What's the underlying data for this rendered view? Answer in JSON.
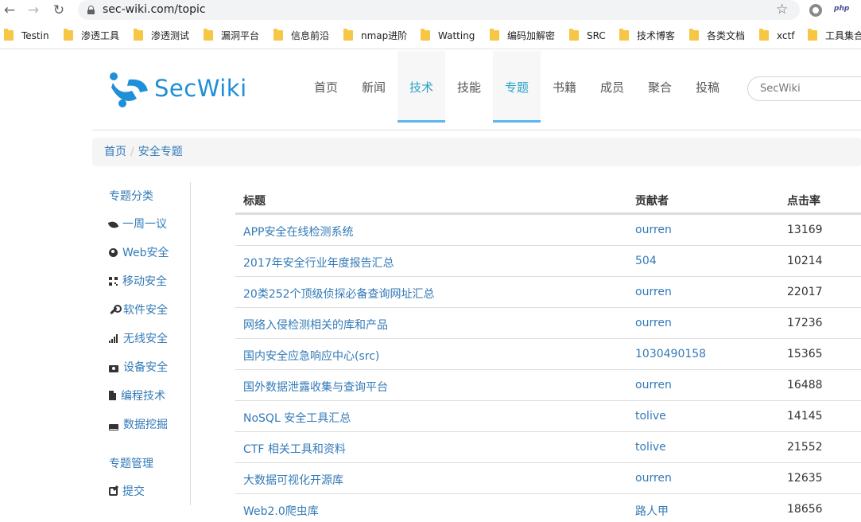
{
  "browser": {
    "url": "sec-wiki.com/topic",
    "php_ext": "php",
    "bookmarks": [
      "Testin",
      "渗透工具",
      "渗透测试",
      "漏洞平台",
      "信息前沿",
      "nmap进阶",
      "Watting",
      "编码加解密",
      "SRC",
      "技术博客",
      "各类文档",
      "xctf",
      "工具集合"
    ]
  },
  "site": {
    "logo_text": "SecWiki",
    "nav": [
      "首页",
      "新闻",
      "技术",
      "技能",
      "专题",
      "书籍",
      "成员",
      "聚合",
      "投稿"
    ],
    "active_nav": [
      "技术",
      "专题"
    ],
    "search_placeholder": "SecWiki",
    "accent_color": "#2aa3c9",
    "link_color": "#337ab7"
  },
  "breadcrumb": {
    "home": "首页",
    "sep": "/",
    "current": "安全专题"
  },
  "sidebar": {
    "category_heading": "专题分类",
    "items": [
      {
        "label": "一周一议",
        "icon": "leaf-icon"
      },
      {
        "label": "Web安全",
        "icon": "globe-icon"
      },
      {
        "label": "移动安全",
        "icon": "qrcode-icon"
      },
      {
        "label": "软件安全",
        "icon": "wrench-icon"
      },
      {
        "label": "无线安全",
        "icon": "signal-icon"
      },
      {
        "label": "设备安全",
        "icon": "camera-icon"
      },
      {
        "label": "编程技术",
        "icon": "file-icon"
      },
      {
        "label": "数据挖掘",
        "icon": "hdd-icon"
      }
    ],
    "manage_heading": "专题管理",
    "manage_items": [
      {
        "label": "提交",
        "icon": "edit-icon"
      }
    ]
  },
  "table": {
    "headers": [
      "标题",
      "贡献者",
      "点击率"
    ],
    "rows": [
      {
        "title": "APP安全在线检测系统",
        "author": "ourren",
        "clicks": "13169"
      },
      {
        "title": "2017年安全行业年度报告汇总",
        "author": "504",
        "clicks": "10214"
      },
      {
        "title": "20类252个顶级侦探必备查询网址汇总",
        "author": "ourren",
        "clicks": "22017"
      },
      {
        "title": "网络入侵检测相关的库和产品",
        "author": "ourren",
        "clicks": "17236"
      },
      {
        "title": "国内安全应急响应中心(src)",
        "author": "1030490158",
        "clicks": "15365"
      },
      {
        "title": "国外数据泄露收集与查询平台",
        "author": "ourren",
        "clicks": "16488"
      },
      {
        "title": "NoSQL 安全工具汇总",
        "author": "tolive",
        "clicks": "14145"
      },
      {
        "title": "CTF 相关工具和资料",
        "author": "tolive",
        "clicks": "21552"
      },
      {
        "title": "大数据可视化开源库",
        "author": "ourren",
        "clicks": "12635"
      },
      {
        "title": "Web2.0爬虫库",
        "author": "路人甲",
        "clicks": "18656"
      }
    ]
  }
}
